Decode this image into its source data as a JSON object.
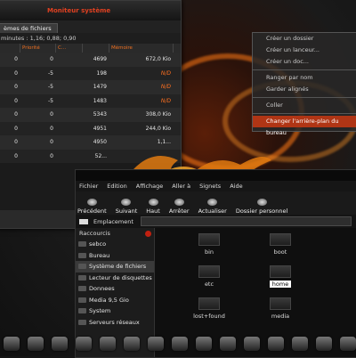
{
  "monitor": {
    "title": "Moniteur système",
    "tab": "èmes de fichiers",
    "load_text": "minutes : 1,16; 0,88; 0,90",
    "columns": [
      "",
      "Priorité",
      "C...",
      "Mémoire"
    ],
    "rows": [
      {
        "a": "0",
        "b": "0",
        "c": "4699",
        "d": "672,0 Kio"
      },
      {
        "a": "0",
        "b": "-5",
        "c": "198",
        "d": "N/D"
      },
      {
        "a": "0",
        "b": "-5",
        "c": "1479",
        "d": "N/D"
      },
      {
        "a": "0",
        "b": "-5",
        "c": "1483",
        "d": "N/D"
      },
      {
        "a": "0",
        "b": "0",
        "c": "5343",
        "d": "308,0 Kio"
      },
      {
        "a": "0",
        "b": "0",
        "c": "4951",
        "d": "244,0 Kio"
      },
      {
        "a": "0",
        "b": "0",
        "c": "4950",
        "d": "1,1..."
      },
      {
        "a": "0",
        "b": "0",
        "c": "52...",
        "d": ""
      }
    ]
  },
  "context_menu": {
    "items": [
      "Créer un dossier",
      "Créer un lanceur...",
      "Créer un doc...",
      "Ranger par nom",
      "Garder alignés",
      "Coller",
      "Changer l'arrière-plan du bureau"
    ]
  },
  "file_manager": {
    "menu": [
      "Fichier",
      "Edition",
      "Affichage",
      "Aller à",
      "Signets",
      "Aide"
    ],
    "toolbar": [
      "Précédent",
      "Suivant",
      "Haut",
      "Arrêter",
      "Actualiser",
      "Dossier personnel"
    ],
    "location_label": "Emplacement",
    "sidebar_header": "Raccourcis",
    "sidebar": [
      "sebco",
      "Bureau",
      "Système de fichiers",
      "Lecteur de disquettes",
      "Donnees",
      "Media 9,5 Gio",
      "System",
      "Serveurs réseaux"
    ],
    "selected_sidebar": "Système de fichiers",
    "files": [
      "bin",
      "boot",
      "etc",
      "home",
      "lost+found",
      "media"
    ],
    "selected_file": "home"
  },
  "colors": {
    "accent": "#e04020",
    "selection": "#b03515"
  }
}
